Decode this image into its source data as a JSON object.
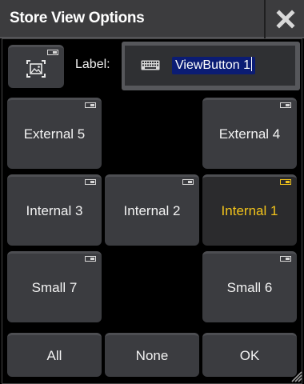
{
  "window": {
    "title": "Store View Options"
  },
  "label_field": {
    "label": "Label:",
    "value": "ViewButton 1"
  },
  "views": [
    {
      "label": "External 5",
      "active": false
    },
    {
      "label": "External 4",
      "active": false
    },
    {
      "label": "Internal 3",
      "active": false
    },
    {
      "label": "Internal 2",
      "active": false
    },
    {
      "label": "Internal 1",
      "active": true
    },
    {
      "label": "Small 7",
      "active": false
    },
    {
      "label": "Small 6",
      "active": false
    }
  ],
  "footer": {
    "all": "All",
    "none": "None",
    "ok": "OK"
  },
  "icons": {
    "close": "close-icon",
    "image": "image-icon",
    "keyboard": "keyboard-icon",
    "resize": "resize-grip-icon"
  },
  "colors": {
    "active_text": "#f2c31b",
    "selection": "#0b1c74"
  }
}
